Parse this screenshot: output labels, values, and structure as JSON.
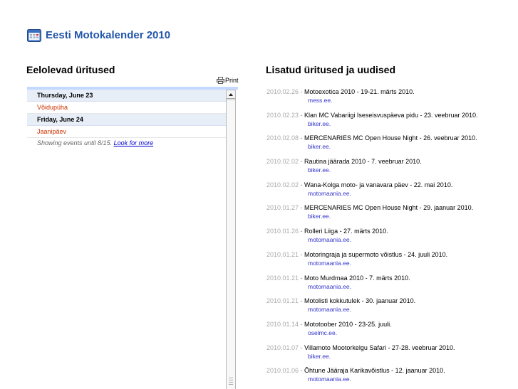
{
  "header": {
    "title": "Eesti Motokalender 2010"
  },
  "left": {
    "heading": "Eelolevad üritused",
    "print_label": "Print",
    "agenda": [
      {
        "date": "Thursday, June 23",
        "events": [
          "Võidupüha"
        ]
      },
      {
        "date": "Friday, June 24",
        "events": [
          "Jaanipäev"
        ]
      }
    ],
    "footer_text": "Showing events until 8/15.",
    "footer_link": "Look for more"
  },
  "right": {
    "heading": "Lisatud üritused ja uudised",
    "items": [
      {
        "date": "2010.02.26",
        "title": "Motoexotica 2010 - 19-21. märts 2010.",
        "source": "mess.ee."
      },
      {
        "date": "2010.02.23",
        "title": "Klan MC Vabariigi Iseseisvuspäeva pidu - 23. veebruar 2010.",
        "source": "biker.ee."
      },
      {
        "date": "2010.02.08",
        "title": "MERCENARIES MC Open House Night - 26. veebruar 2010.",
        "source": "biker.ee."
      },
      {
        "date": "2010.02.02",
        "title": "Rautina jäärada 2010 - 7. veebruar 2010.",
        "source": "biker.ee."
      },
      {
        "date": "2010.02.02",
        "title": "Wana-Kolga moto- ja vanavara päev - 22. mai 2010.",
        "source": "motomaania.ee."
      },
      {
        "date": "2010.01.27",
        "title": "MERCENARIES MC Open House Night - 29. jaanuar 2010.",
        "source": "biker.ee."
      },
      {
        "date": "2010.01.26",
        "title": "Rolleri Liiga - 27. märts 2010.",
        "source": "motomaania.ee."
      },
      {
        "date": "2010.01.21",
        "title": "Motoringraja ja supermoto võistlus - 24. juuli 2010.",
        "source": "motomaania.ee."
      },
      {
        "date": "2010.01.21",
        "title": "Moto Murdmaa 2010 - 7. märts 2010.",
        "source": "motomaania.ee."
      },
      {
        "date": "2010.01.21",
        "title": "Motolisti kokkutulek - 30. jaanuar 2010.",
        "source": "motomaania.ee."
      },
      {
        "date": "2010.01.14",
        "title": "Mototoober 2010 - 23-25. juuli.",
        "source": "oselmc.ee."
      },
      {
        "date": "2010.01.07",
        "title": "Villamoto Mootorkelgu Safari - 27-28. veebruar 2010.",
        "source": "biker.ee."
      },
      {
        "date": "2010.01.06",
        "title": "Õhtune Jääraja Karikavõistlus - 12. jaanuar 2010.",
        "source": "motomaania.ee."
      }
    ]
  }
}
